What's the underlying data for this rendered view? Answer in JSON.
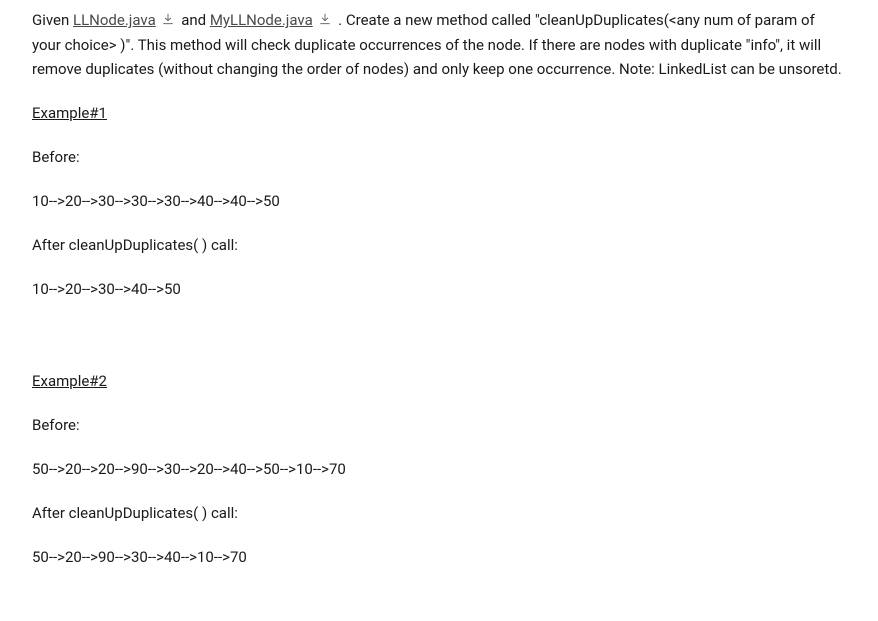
{
  "intro": {
    "prefix": "Given ",
    "link1_label": "LLNode.java",
    "mid1": " and ",
    "link2_label": "MyLLNode.java",
    "mid2": " . ",
    "rest": "Create a new method called \"cleanUpDuplicates(<any num of param of your choice> )\". This method will check duplicate occurrences of the node. If there are nodes with duplicate \"info\", it will remove duplicates (without changing the order of nodes) and only keep one occurrence. Note: LinkedList can be unsoretd."
  },
  "examples": [
    {
      "heading": "Example#1",
      "before_label": "Before:",
      "before_chain": "10-->20-->30-->30-->30-->40-->40-->50",
      "after_label": "After cleanUpDuplicates( ) call:",
      "after_chain": "10-->20-->30-->40-->50"
    },
    {
      "heading": "Example#2",
      "before_label": "Before:",
      "before_chain": "50-->20-->20-->90-->30-->20-->40-->50-->10-->70",
      "after_label": "After cleanUpDuplicates( ) call:",
      "after_chain": "50-->20-->90-->30-->40-->10-->70"
    }
  ]
}
